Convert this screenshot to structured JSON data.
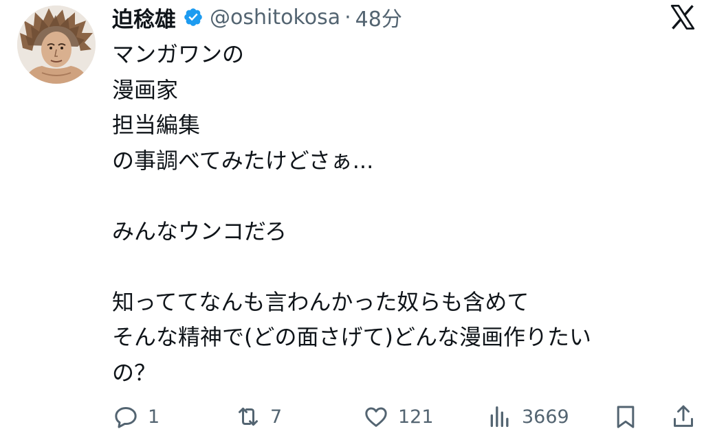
{
  "tweet": {
    "author_name": "迫稔雄",
    "handle": "@oshitokosa",
    "separator": "·",
    "time": "48分",
    "lines": [
      "マンガワンの",
      "漫画家",
      "担当編集",
      "の事調べてみたけどさぁ...",
      "",
      "みんなウンコだろ",
      "",
      "知っててなんも言わんかった奴らも含めて",
      "そんな精神で(どの面さげて)どんな漫画作りたい",
      "の？"
    ]
  },
  "actions": {
    "reply_count": "1",
    "repost_count": "7",
    "like_count": "121",
    "views_count": "3669"
  },
  "colors": {
    "verified": "#1d9bf0",
    "secondary_text": "#536471",
    "primary_text": "#0f1419"
  },
  "icons": [
    "avatar",
    "verified-badge-icon",
    "x-logo-icon",
    "reply-icon",
    "repost-icon",
    "like-icon",
    "views-icon",
    "bookmark-icon",
    "share-icon"
  ]
}
